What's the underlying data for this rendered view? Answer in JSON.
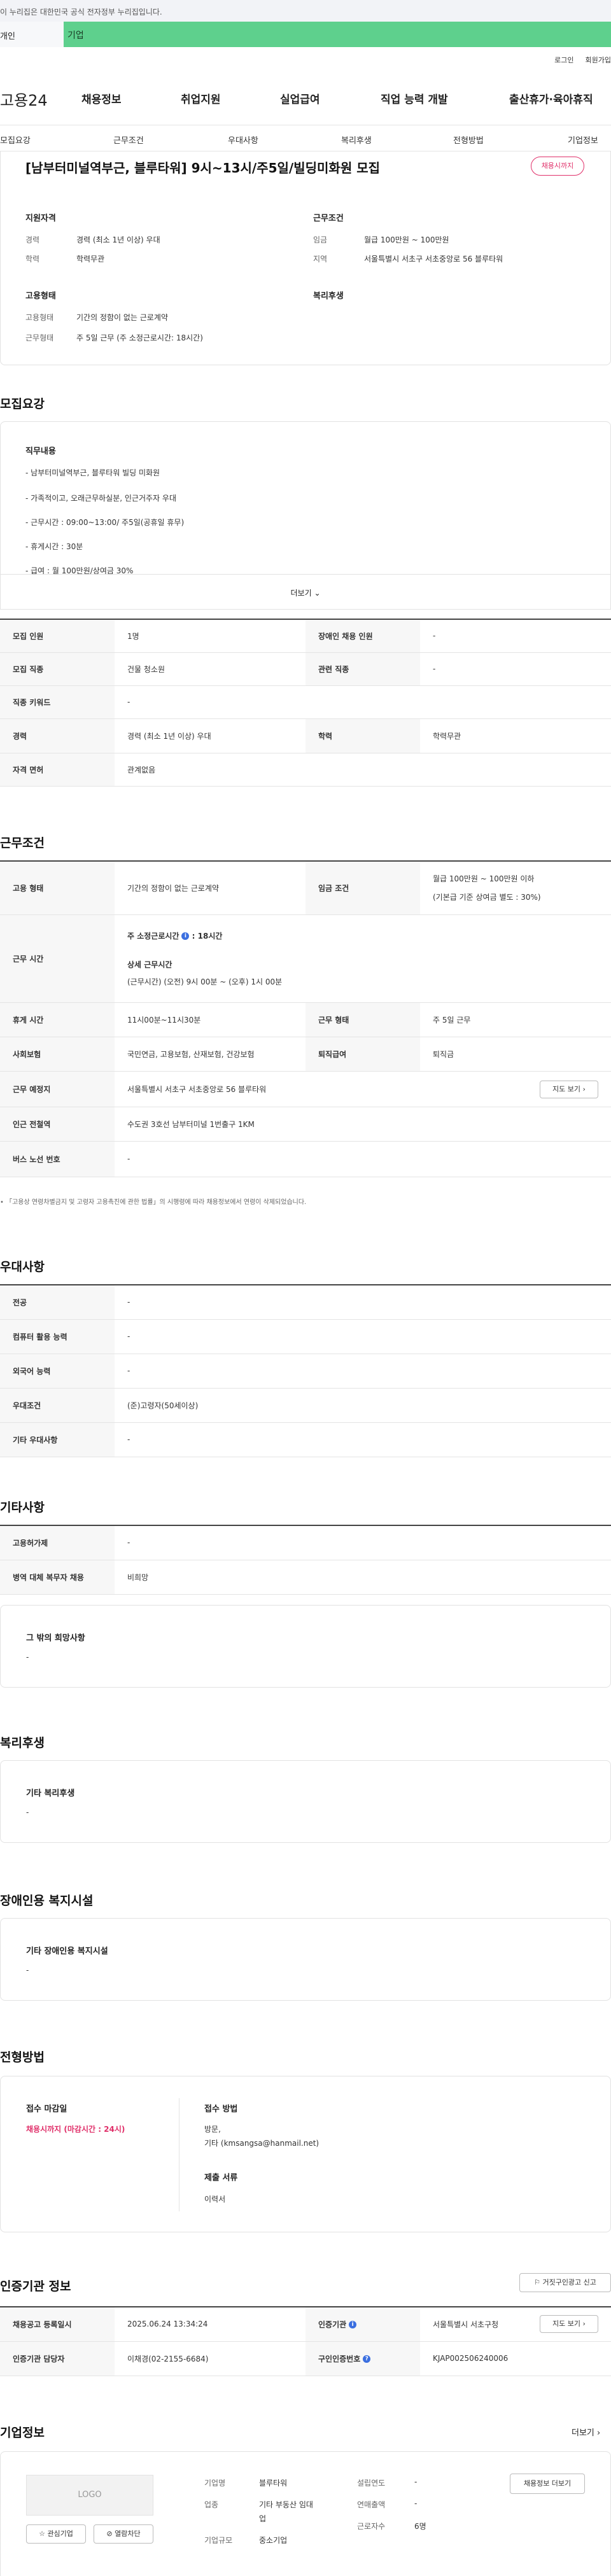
{
  "gov_banner": "이 누리집은 대한민국 공식 전자정부 누리집입니다.",
  "top_tabs": {
    "personal": "개인",
    "company": "기업"
  },
  "util": {
    "login": "로그인",
    "join": "회원가입"
  },
  "logo": "고용24",
  "gnb": [
    "채용정보",
    "취업지원",
    "실업급여",
    "직업 능력 개발",
    "출산휴가·육아휴직"
  ],
  "subnav": [
    "모집요강",
    "근무조건",
    "우대사항",
    "복리후생",
    "전형방법",
    "기업정보"
  ],
  "title": "[남부터미널역부근, 블루타워] 9시~13시/주5일/빌딩미화원 모집",
  "deadline_badge": "채용시까지",
  "summary": {
    "qual_title": "지원자격",
    "career_k": "경력",
    "career_v": "경력 (최소 1년 이상) 우대",
    "edu_k": "학력",
    "edu_v": "학력무관",
    "cond_title": "근무조건",
    "wage_k": "임금",
    "wage_v": "월급 100만원 ~ 100만원",
    "region_k": "지역",
    "region_v": "서울특별시 서초구 서초중앙로 56 블루타워",
    "emp_title": "고용형태",
    "emptype_k": "고용형태",
    "emptype_v": "기간의 정함이 없는 근로계약",
    "worktype_k": "근무형태",
    "worktype_v": "주 5일 근무 (주 소정근로시간: 18시간)",
    "welfare_title": "복리후생"
  },
  "recruit": {
    "section": "모집요강",
    "job_title": "직무내용",
    "lines": [
      "- 남부터미널역부근, 블루타워 빌딩 미화원",
      "- 가족적이고, 오래근무하실분, 인근거주자 우대",
      "- 근무시간 : 09:00~13:00/ 주5일(공휴일 휴무)",
      "- 휴게시간 : 30분",
      "- 급여 : 월 100만원/상여금 30%"
    ],
    "more": "더보기",
    "rows": [
      {
        "k1": "모집 인원",
        "v1": "1명",
        "k2": "장애인 채용 인원",
        "v2": "-"
      },
      {
        "k1": "모집 직종",
        "v1": "건물 청소원",
        "k2": "관련 직종",
        "v2": "-"
      },
      {
        "k1": "직종 키워드",
        "v1": "-"
      },
      {
        "k1": "경력",
        "v1": "경력 (최소 1년 이상) 우대",
        "k2": "학력",
        "v2": "학력무관"
      },
      {
        "k1": "자격 면허",
        "v1": "관계없음"
      }
    ]
  },
  "conditions": {
    "section": "근무조건",
    "emp_k": "고용 형태",
    "emp_v": "기간의 정함이 없는 근로계약",
    "wage_k": "임금 조건",
    "wage_v1": "월급 100만원 ~ 100만원 이하",
    "wage_v2": "(기본급 기준 상여금 별도 : 30%)",
    "hours_k": "근무 시간",
    "hours_weekly_label": "주 소정근로시간",
    "hours_weekly_val": ": 18시간",
    "hours_detail_label": "상세 근무시간",
    "hours_detail_val": "(근무시간) (오전) 9시 00분 ~ (오후) 1시 00분",
    "rest_k": "휴게 시간",
    "rest_v": "11시00분~11시30분",
    "form_k": "근무 형태",
    "form_v": "주 5일 근무",
    "ins_k": "사회보험",
    "ins_v": "국민연금, 고용보험, 산재보험, 건강보험",
    "sev_k": "퇴직급여",
    "sev_v": "퇴직금",
    "loc_k": "근무 예정지",
    "loc_v": "서울특별시 서초구 서초중앙로 56 블루타워",
    "map_btn": "지도 보기",
    "subway_k": "인근 전철역",
    "subway_v": "수도권 3호선 남부터미널 1번출구 1KM",
    "bus_k": "버스 노선 번호",
    "bus_v": "-",
    "note": "「고용상 연령차별금지 및 고령자 고용촉진에 관한 법률」의 시행령에 따라 채용정보에서 연령이 삭제되었습니다."
  },
  "preference": {
    "section": "우대사항",
    "rows": [
      {
        "k": "전공",
        "v": "-"
      },
      {
        "k": "컴퓨터 활용 능력",
        "v": "-"
      },
      {
        "k": "외국어 능력",
        "v": "-"
      },
      {
        "k": "우대조건",
        "v": "(준)고령자(50세이상)"
      },
      {
        "k": "기타 우대사항",
        "v": "-"
      }
    ]
  },
  "etc": {
    "section": "기타사항",
    "rows": [
      {
        "k": "고용허가제",
        "v": "-"
      },
      {
        "k": "병역 대체 복무자 채용",
        "v": "비희망"
      }
    ],
    "other_title": "그 밖의 희망사항",
    "other_v": "-"
  },
  "welfare": {
    "section": "복리후생",
    "title": "기타 복리후생",
    "v": "-"
  },
  "disabled": {
    "section": "장애인용 복지시설",
    "title": "기타 장애인용 복지시설",
    "v": "-"
  },
  "selection": {
    "section": "전형방법",
    "deadline_title": "접수 마감일",
    "deadline_v": "채용시까지 (마감시간 : 24시)",
    "method_title": "접수 방법",
    "method_v1": "방문,",
    "method_v2": "기타 (kmsangsa@hanmail.net)",
    "docs_title": "제출 서류",
    "docs_v": "이력서"
  },
  "cert": {
    "section": "인증기관 정보",
    "report_btn": "거짓구인광고 신고",
    "reg_k": "채용공고 등록일시",
    "reg_v": "2025.06.24 13:34:24",
    "org_k": "인증기관",
    "org_v": "서울특별시 서초구청",
    "map_btn": "지도 보기",
    "mgr_k": "인증기관 담당자",
    "mgr_v": "이채경(02-2155-6684)",
    "no_k": "구인인증번호",
    "no_v": "KJAP002506240006"
  },
  "company": {
    "section": "기업정보",
    "more": "더보기",
    "logo": "LOGO",
    "interest_btn": "관심기업",
    "block_btn": "열람차단",
    "name_k": "기업명",
    "name_v": "블루타워",
    "industry_k": "업종",
    "industry_v1": "기타 부동산 임대",
    "industry_v2": "업",
    "size_k": "기업규모",
    "size_v": "중소기업",
    "founded_k": "설립연도",
    "founded_v": "-",
    "sales_k": "연매출액",
    "sales_v": "-",
    "staff_k": "근로자수",
    "staff_v": "6명",
    "jobs_btn": "채용정보 더보기"
  }
}
